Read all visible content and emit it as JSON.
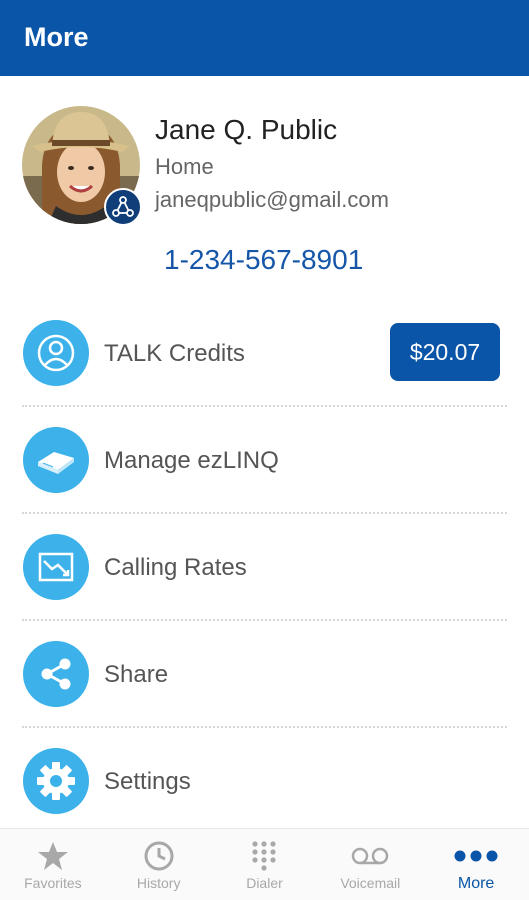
{
  "app_bar": {
    "title": "More"
  },
  "profile": {
    "name": "Jane Q. Public",
    "type": "Home",
    "email": "janeqpublic@gmail.com",
    "phone": "1-234-567-8901",
    "badge_icon": "network-icon"
  },
  "menu": {
    "items": [
      {
        "label": "TALK Credits",
        "icon": "person-silhouette-icon"
      },
      {
        "label": "Manage ezLINQ",
        "icon": "device-icon"
      },
      {
        "label": "Calling Rates",
        "icon": "chart-down-icon"
      },
      {
        "label": "Share",
        "icon": "share-icon"
      },
      {
        "label": "Settings",
        "icon": "gear-icon"
      }
    ],
    "credit_amount": "$20.07"
  },
  "bottom_nav": {
    "items": [
      {
        "label": "Favorites",
        "icon": "star-icon"
      },
      {
        "label": "History",
        "icon": "clock-icon"
      },
      {
        "label": "Dialer",
        "icon": "dialpad-icon"
      },
      {
        "label": "Voicemail",
        "icon": "voicemail-icon"
      },
      {
        "label": "More",
        "icon": "more-dots-icon",
        "active": true
      }
    ]
  },
  "colors": {
    "primary": "#0a55a8",
    "accent": "#3db2ea",
    "phone_text": "#1556a8",
    "inactive_nav": "#a8a8a8"
  }
}
